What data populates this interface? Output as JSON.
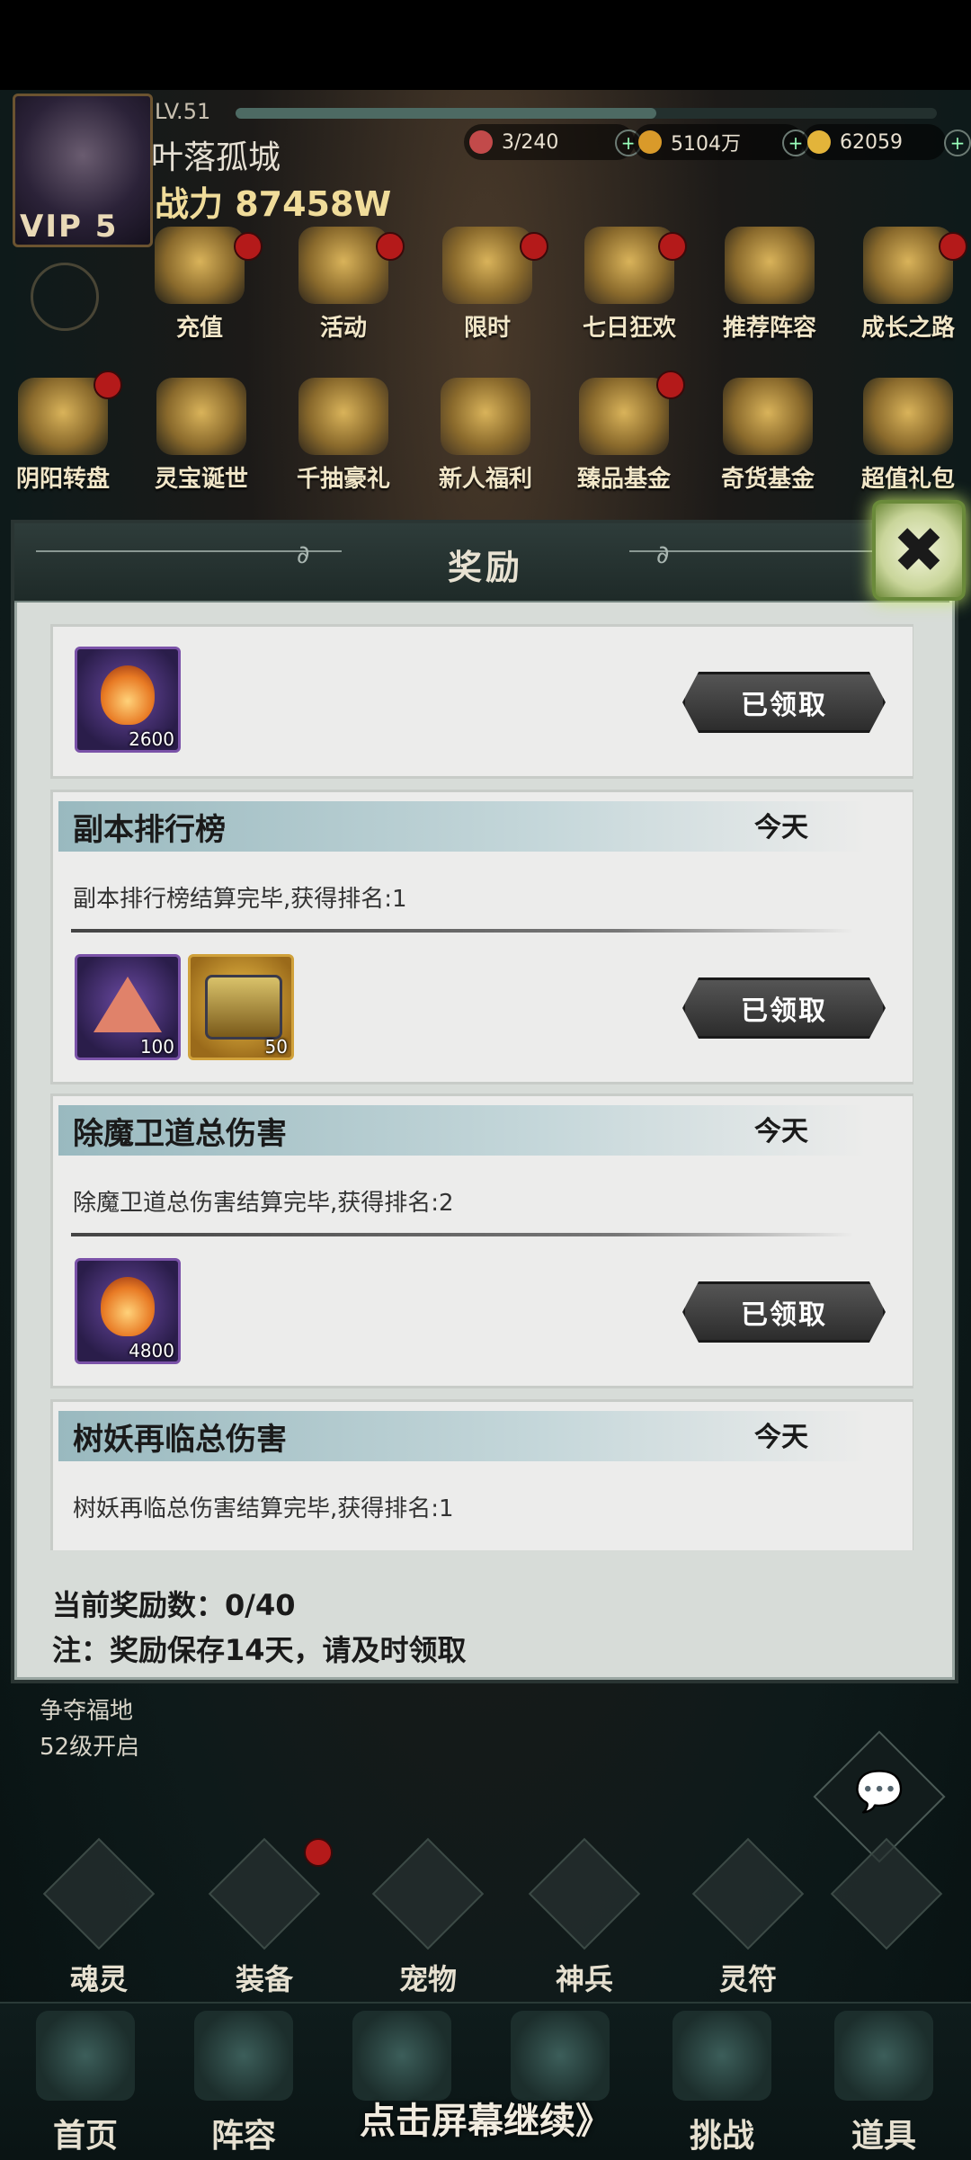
{
  "player": {
    "level": "LV.51",
    "vip": "VIP 5",
    "name": "叶落孤城",
    "power": "战力 87458W"
  },
  "resources": [
    {
      "value": "3/240"
    },
    {
      "value": "5104万"
    },
    {
      "value": "62059"
    }
  ],
  "top_menu_row1": [
    "充值",
    "活动",
    "限时",
    "七日狂欢",
    "推荐阵容",
    "成长之路"
  ],
  "top_menu_row2": [
    "阴阳转盘",
    "灵宝诞世",
    "千抽豪礼",
    "新人福利",
    "臻品基金",
    "奇货基金",
    "超值礼包"
  ],
  "modal": {
    "title": "奖励",
    "claim_label": "已领取",
    "cards": [
      {
        "title": "",
        "date": "",
        "desc": "",
        "items": [
          {
            "count": "2600"
          }
        ]
      },
      {
        "title": "副本排行榜",
        "date": "今天",
        "desc": "副本排行榜结算完毕,获得排名:1",
        "items": [
          {
            "count": "100"
          },
          {
            "count": "50"
          }
        ]
      },
      {
        "title": "除魔卫道总伤害",
        "date": "今天",
        "desc": "除魔卫道总伤害结算完毕,获得排名:2",
        "items": [
          {
            "count": "4800"
          }
        ]
      },
      {
        "title": "树妖再临总伤害",
        "date": "今天",
        "desc": "树妖再临总伤害结算完毕,获得排名:1",
        "items": []
      }
    ],
    "count_text": "当前奖励数：0/40",
    "note_text": "注：奖励保存14天，请及时领取"
  },
  "side": {
    "event_name": "争夺福地",
    "event_unlock": "52级开启"
  },
  "bottom_row": [
    "魂灵",
    "装备",
    "宠物",
    "神兵",
    "灵符"
  ],
  "nav": [
    "首页",
    "阵容",
    "",
    "",
    "挑战",
    "道具"
  ],
  "continue_hint": "点击屏幕继续》"
}
